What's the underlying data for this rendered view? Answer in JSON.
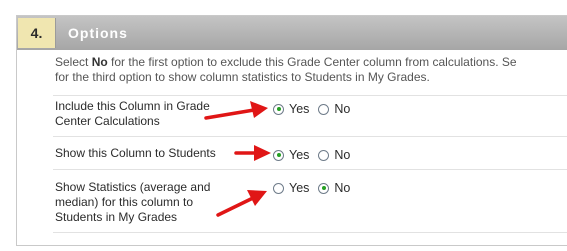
{
  "section": {
    "number": "4.",
    "title": "Options"
  },
  "instructions": {
    "line1_pre": "Select ",
    "line1_bold": "No",
    "line1_post": " for the first option to exclude this Grade Center column from calculations. Se",
    "line2": "for the third option to show column statistics to Students in My Grades."
  },
  "options": [
    {
      "label": "Include this Column in Grade\nCenter Calculations",
      "yes_label": "Yes",
      "no_label": "No",
      "selected": "Yes"
    },
    {
      "label": "Show this Column to Students",
      "yes_label": "Yes",
      "no_label": "No",
      "selected": "Yes"
    },
    {
      "label": "Show Statistics (average and\nmedian) for this column to\nStudents in My Grades",
      "yes_label": "Yes",
      "no_label": "No",
      "selected": "No"
    }
  ],
  "colors": {
    "header": "#b3b3b3",
    "step_badge": "#f0e6b0",
    "selected_radio": "#25a024",
    "annotation_arrow": "#e01616"
  }
}
